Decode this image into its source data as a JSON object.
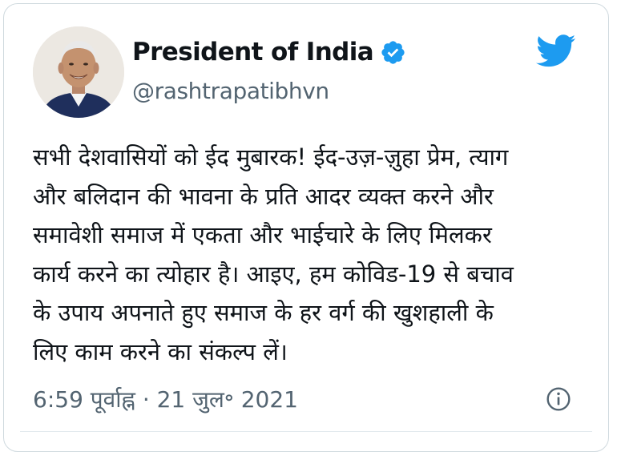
{
  "author": {
    "display_name": "President of India",
    "handle": "@rashtrapatibhvn",
    "verified": true
  },
  "icons": {
    "verified": "verified-badge-icon",
    "logo": "twitter-bird-icon",
    "info": "info-icon"
  },
  "tweet": {
    "lines": [
      "सभी देशवासियों को ईद मुबारक! ईद-उज़-ज़ुहा प्रेम, त्याग",
      "और बलिदान की भावना के प्रति आदर व्यक्त करने और",
      "समावेशी समाज में एकता और भाईचारे के लिए मिलकर",
      "कार्य करने का त्योहार है। आइए, हम कोविड-19 से बचाव",
      "के उपाय अपनाते हुए समाज के हर वर्ग की खुशहाली के",
      "लिए काम करने का संकल्प लें।"
    ],
    "timestamp": "6:59 पूर्वाह्न · 21 जुल॰ 2021"
  },
  "colors": {
    "twitter_blue": "#1d9bf0",
    "text": "#0f1419",
    "secondary_text": "#536471",
    "border": "#cfd9de"
  }
}
